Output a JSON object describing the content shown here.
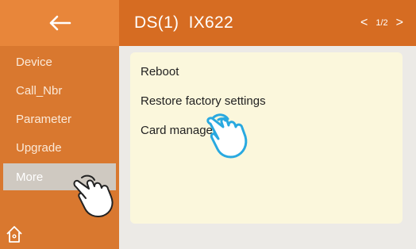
{
  "header": {
    "title": "DS(1)  IX622",
    "page_indicator": "1/2"
  },
  "sidebar": {
    "items": [
      {
        "label": "Device"
      },
      {
        "label": "Call_Nbr"
      },
      {
        "label": "Parameter"
      },
      {
        "label": "Upgrade"
      },
      {
        "label": "More"
      }
    ],
    "active_item": "More"
  },
  "panel": {
    "options": [
      {
        "label": "Reboot"
      },
      {
        "label": "Restore factory settings"
      },
      {
        "label": "Card manager"
      }
    ]
  },
  "icons": {
    "back": "arrow-left-icon",
    "prev": "chevron-left-icon",
    "next": "chevron-right-icon",
    "home": "home-icon",
    "pointer": "hand-pointer-icon"
  },
  "colors": {
    "sidebar": "#d9782f",
    "header": "#d66c22",
    "active_item": "#cfc9c1",
    "panel": "#fbf7dc",
    "pointer": "#29a9e0"
  }
}
